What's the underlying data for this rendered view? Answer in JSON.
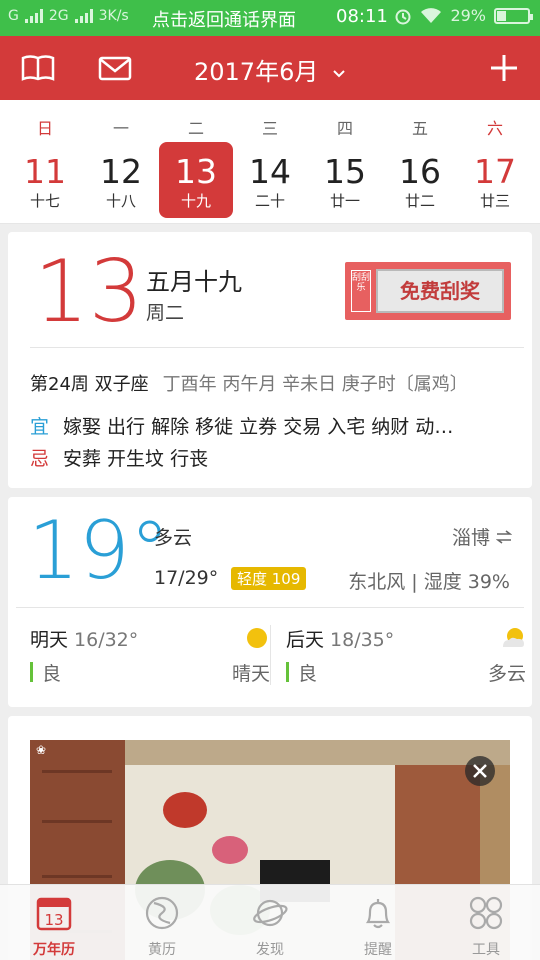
{
  "status_bar": {
    "network_label_1": "G",
    "network_label_2": "2G",
    "speed": "3K/s",
    "notice": "点击返回通话界面",
    "time": "08:11",
    "battery": "29%"
  },
  "header": {
    "title": "2017年6月",
    "book_icon": "book-icon",
    "mail_icon": "mail-icon",
    "add_icon": "plus-icon"
  },
  "week": {
    "days": [
      {
        "weekday": "日",
        "day": "11",
        "lunar": "十七",
        "weekend": true,
        "selected": false
      },
      {
        "weekday": "一",
        "day": "12",
        "lunar": "十八",
        "weekend": false,
        "selected": false
      },
      {
        "weekday": "二",
        "day": "13",
        "lunar": "十九",
        "weekend": false,
        "selected": true
      },
      {
        "weekday": "三",
        "day": "14",
        "lunar": "二十",
        "weekend": false,
        "selected": false
      },
      {
        "weekday": "四",
        "day": "15",
        "lunar": "廿一",
        "weekend": false,
        "selected": false
      },
      {
        "weekday": "五",
        "day": "16",
        "lunar": "廿二",
        "weekend": false,
        "selected": false
      },
      {
        "weekday": "六",
        "day": "17",
        "lunar": "廿三",
        "weekend": true,
        "selected": false
      }
    ]
  },
  "today": {
    "day": "13",
    "lunar_date": "五月十九",
    "weekday": "周二",
    "lottery_stamp": "刮刮乐",
    "lottery_button": "免费刮奖",
    "week_info": "第24周 双子座",
    "ganzhi": "丁酉年 丙午月 辛未日 庚子时〔属鸡〕",
    "yi_label": "宜",
    "yi": "嫁娶 出行 解除 移徙 立券 交易 入宅 纳财 动…",
    "ji_label": "忌",
    "ji": "安葬 开生坟 行丧"
  },
  "weather": {
    "temp": "19°",
    "desc": "多云",
    "range": "17/29°",
    "aqi": "轻度 109",
    "city": "淄博",
    "wind": "东北风 | 湿度 39%",
    "forecast": [
      {
        "name": "明天",
        "range": "16/32°",
        "quality": "良",
        "condition": "晴天",
        "icon": "sun-icon"
      },
      {
        "name": "后天",
        "range": "18/35°",
        "quality": "良",
        "condition": "多云",
        "icon": "partly-cloudy-icon"
      }
    ]
  },
  "ad": {
    "image": "living-room-wall-art-ad",
    "close_icon": "close-icon"
  },
  "bottom_nav": {
    "items": [
      {
        "label": "万年历",
        "icon": "calendar-icon",
        "active": true,
        "icon_text": "13"
      },
      {
        "label": "黄历",
        "icon": "yin-yang-icon",
        "active": false
      },
      {
        "label": "发现",
        "icon": "planet-icon",
        "active": false
      },
      {
        "label": "提醒",
        "icon": "bell-icon",
        "active": false
      },
      {
        "label": "工具",
        "icon": "grid-icon",
        "active": false
      }
    ]
  },
  "colors": {
    "primary": "#d33a3a",
    "status_bar": "#3fbf4a",
    "weather_blue": "#2a9fd6",
    "aqi_yellow": "#e6b800",
    "quality_green": "#65c23a"
  }
}
